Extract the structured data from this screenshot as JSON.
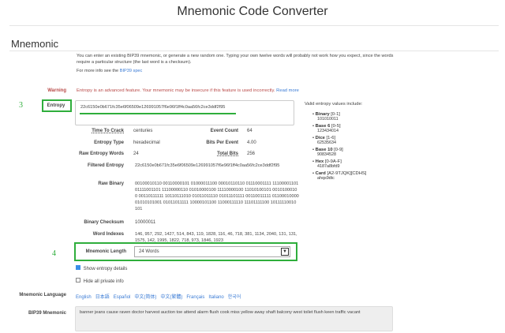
{
  "header": {
    "title": "Mnemonic Code Converter"
  },
  "section_title": "Mnemonic",
  "intro": {
    "text": "You can enter an existing BIP39 mnemonic, or generate a new random one. Typing your own twelve words will probably not work how you expect, since the words require a particular structure (the last word is a checksum).",
    "more_prefix": "For more info see the ",
    "more_link": "BIP39 spec"
  },
  "warning": {
    "label": "Warning",
    "text": "Entropy is an advanced feature. Your mnemonic may be insecure if this feature is used incorrectly.",
    "read_more": "Read more"
  },
  "annotations": {
    "a3": "3",
    "a4": "4"
  },
  "entropy": {
    "label": "Entropy",
    "value": "22c6150e0b671fc35e6f06509e126991057f6e96f1ff4c0aa56fc2ce3ddf2f95"
  },
  "entropy_help": {
    "title": "Valid entropy values include:",
    "items": [
      {
        "name": "Binary",
        "range": "[0-1]",
        "example": "101010011"
      },
      {
        "name": "Base 6",
        "range": "[0-5]",
        "example": "123434014"
      },
      {
        "name": "Dice",
        "range": "[1-6]",
        "example": "62535634"
      },
      {
        "name": "Base 10",
        "range": "[0-9]",
        "example": "90834528"
      },
      {
        "name": "Hex",
        "range": "[0-9A-F]",
        "example": "4187a8bfd9"
      },
      {
        "name": "Card",
        "range": "[A2-9TJQK][CDHS]",
        "example": "ahqs9dtc"
      }
    ]
  },
  "details": {
    "time_to_crack_label": "Time To Crack",
    "time_to_crack": "centuries",
    "event_count_label": "Event Count",
    "event_count": "64",
    "entropy_type_label": "Entropy Type",
    "entropy_type": "hexadecimal",
    "bits_per_event_label": "Bits Per Event",
    "bits_per_event": "4.00",
    "raw_words_label": "Raw Entropy Words",
    "raw_words": "24",
    "total_bits_label": "Total Bits",
    "total_bits": "256",
    "filtered_label": "Filtered Entropy",
    "filtered": "22c6150e0b671fc35e6f06509e126991057f6e96f1ff4c0aa56fc2ce3ddf2f95",
    "raw_binary_label": "Raw Binary",
    "raw_binary": "00100010110 00110000101 01000011100 00010110110 01110001111 11100001101 01111001101 11100000110 01010000100 11110000100 11010100101 00101000100 00110111111 10110111010 01011011110 01011101111 00110011111 01100010000 01010101001 01011011111 10000101100 11000111110 11101111100 10111110010 101",
    "checksum_label": "Binary Checksum",
    "checksum": "10000011",
    "word_indexes_label": "Word Indexes",
    "word_indexes": "146, 957, 292, 1427, 514, 843, 119, 1828, 116, 46, 718, 381, 1134, 2040, 131, 131, 1575, 142, 1995, 1822, 718, 973, 1846, 1923"
  },
  "mnemonic_length": {
    "label": "Mnemonic Length",
    "value": "24 Words"
  },
  "checks": {
    "show_details": "Show entropy details",
    "hide_private": "Hide all private info"
  },
  "language": {
    "label": "Mnemonic Language",
    "options": [
      "English",
      "日本語",
      "Español",
      "中文(简体)",
      "中文(繁體)",
      "Français",
      "Italiano",
      "한국어"
    ]
  },
  "bip39": {
    "label": "BIP39 Mnemonic",
    "value": "banner jeans cause raven doctor harvest auction toe attend alarm flush cook miss yellow away shaft balcony west toilet flush keen traffic vacant"
  },
  "colors": {
    "annotation": "#2fae3c",
    "link": "#3a7bd5",
    "warning": "#b94a48"
  }
}
